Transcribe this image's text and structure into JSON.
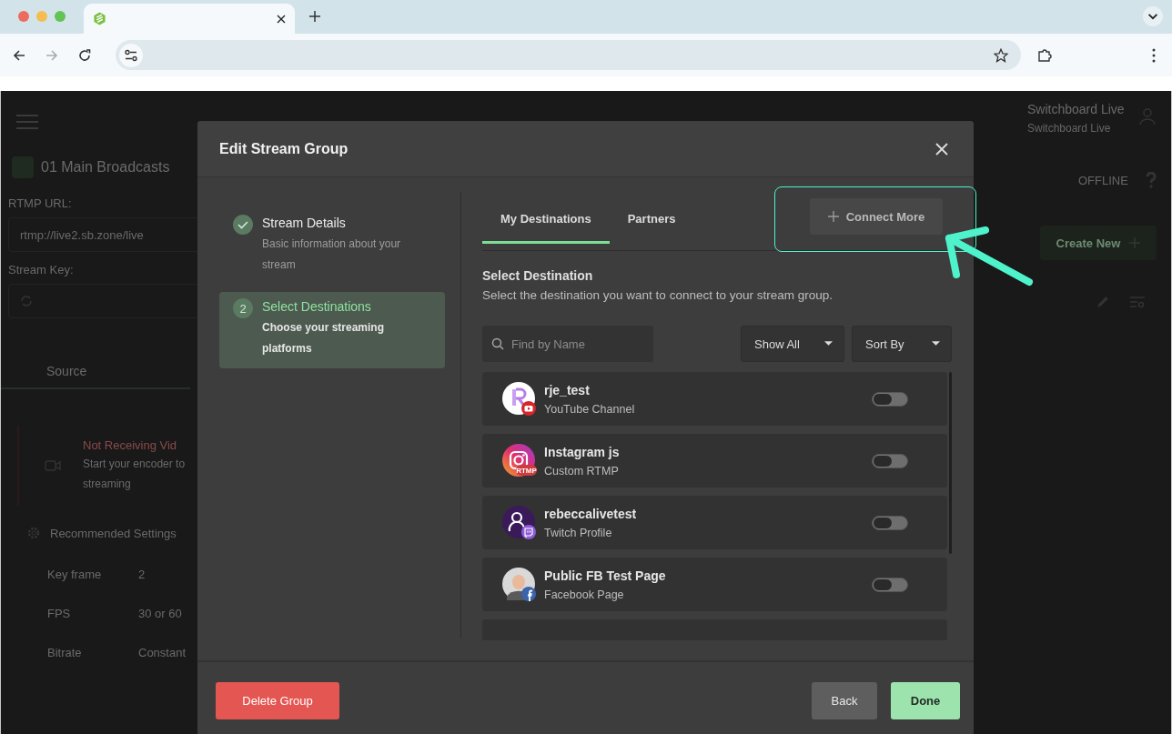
{
  "background": {
    "project": "01 Main Broadcasts",
    "rtmp_label": "RTMP URL:",
    "rtmp_url": "rtmp://live2.sb.zone/live",
    "stream_key_label": "Stream Key:",
    "tab": "Source",
    "alert_title": "Not Receiving Vid",
    "alert_lines": [
      "Start your encoder to",
      "streaming"
    ],
    "settings_title": "Recommended Settings",
    "settings": [
      {
        "label": "Key frame",
        "value": "2"
      },
      {
        "label": "FPS",
        "value": "30 or 60"
      },
      {
        "label": "Bitrate",
        "value": "Constant"
      }
    ],
    "account_name": "Switchboard Live",
    "account_sub": "Switchboard Live",
    "status": "OFFLINE",
    "create_button": "Create New"
  },
  "modal": {
    "title": "Edit Stream Group",
    "steps": [
      {
        "title": "Stream Details",
        "subtitle": "Basic information about your stream",
        "done": true,
        "selected": false
      },
      {
        "number": "2",
        "title": "Select Destinations",
        "subtitle": "Choose your streaming platforms",
        "done": false,
        "selected": true
      }
    ],
    "tabs": [
      {
        "label": "My Destinations",
        "selected": true
      },
      {
        "label": "Partners",
        "selected": false
      }
    ],
    "connect_button": "Connect More",
    "section_title": "Select Destination",
    "section_text": "Select the destination you want to connect to your stream group.",
    "search": {
      "placeholder": "Find by Name"
    },
    "filters": [
      "Show All",
      "Sort By"
    ],
    "destinations": [
      {
        "name": "rje_test",
        "type": "YouTube Channel",
        "kind": "youtube",
        "on": false
      },
      {
        "name": "Instagram js",
        "type": "Custom RTMP",
        "kind": "rtmp",
        "badge_text": "RTMP",
        "on": false
      },
      {
        "name": "rebeccalivetest",
        "type": "Twitch Profile",
        "kind": "twitch",
        "on": false
      },
      {
        "name": "Public FB Test Page",
        "type": "Facebook Page",
        "kind": "facebook",
        "on": false
      }
    ],
    "delete_button": "Delete Group",
    "back_button": "Back",
    "done_button": "Done"
  }
}
